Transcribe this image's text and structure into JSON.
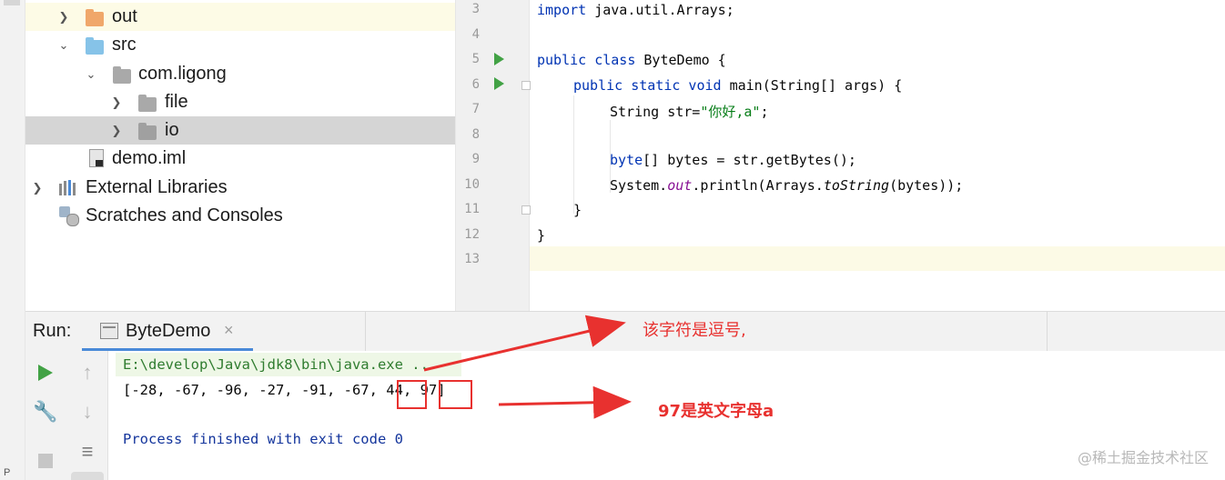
{
  "project_tree": {
    "items": [
      {
        "label": "out",
        "icon": "folder-orange-icon",
        "expand": "chevron-right"
      },
      {
        "label": "src",
        "icon": "folder-blue-icon",
        "expand": "chevron-down"
      },
      {
        "label": "com.ligong",
        "icon": "package-icon",
        "expand": "chevron-down"
      },
      {
        "label": "file",
        "icon": "package-icon",
        "expand": "chevron-right"
      },
      {
        "label": "io",
        "icon": "package-icon",
        "expand": "chevron-right"
      },
      {
        "label": "demo.iml",
        "icon": "iml-file-icon",
        "expand": ""
      },
      {
        "label": "External Libraries",
        "icon": "libraries-icon",
        "expand": "chevron-right"
      },
      {
        "label": "Scratches and Consoles",
        "icon": "scratches-icon",
        "expand": ""
      }
    ]
  },
  "editor": {
    "line_numbers": [
      "3",
      "4",
      "5",
      "6",
      "7",
      "8",
      "9",
      "10",
      "11",
      "12",
      "13"
    ],
    "code": {
      "l3_kw": "import",
      "l3_rest": " java.util.Arrays;",
      "l5_kw": "public class",
      "l5_rest": " ByteDemo {",
      "l6_kw": "public static void",
      "l6_rest": " main(String[] args) {",
      "l7_a": "String str=",
      "l7_str": "\"你好,a\"",
      "l7_b": ";",
      "l9_kw": "byte",
      "l9_rest": "[] bytes = str.getBytes();",
      "l10_a": "System.",
      "l10_out": "out",
      "l10_b": ".println(Arrays.",
      "l10_ts": "toString",
      "l10_c": "(bytes));",
      "l11": "}",
      "l12": "}"
    }
  },
  "run_panel": {
    "label": "Run:",
    "tab_label": "ByteDemo",
    "tab_close": "×",
    "console": {
      "command": "E:\\develop\\Java\\jdk8\\bin\\java.exe ...",
      "output": "[-28, -67, -96, -27, -91, -67, 44, 97]",
      "exit": "Process finished with exit code 0"
    }
  },
  "annotations": {
    "comma_note": "该字符是逗号,",
    "letter_note": "97是英文字母a"
  },
  "watermark": "@稀土掘金技术社区",
  "colors": {
    "keyword": "#0033b3",
    "string": "#067d17",
    "annotation": "#e8312f",
    "run_green": "#42a245"
  }
}
